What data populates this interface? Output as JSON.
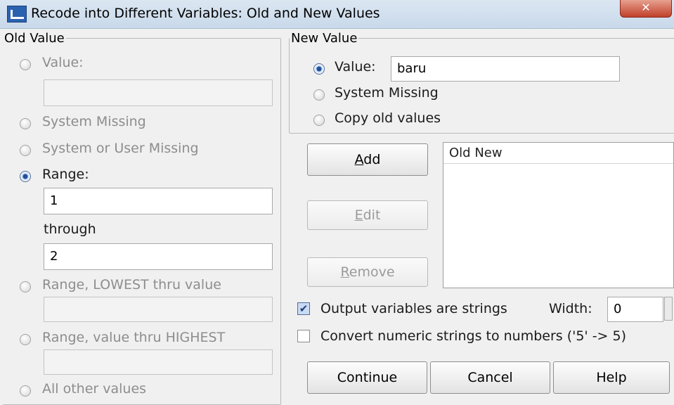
{
  "window": {
    "title": "Recode into Different Variables: Old and New Values",
    "close_label": "✕"
  },
  "old_value": {
    "legend": "Old Value",
    "value_label": "Value:",
    "system_missing_label": "System Missing",
    "system_or_user_missing_label": "System or User Missing",
    "range_label": "Range:",
    "range_from": "1",
    "through_label": "through",
    "range_to": "2",
    "range_lowest_label": "Range, LOWEST thru value",
    "range_highest_label": "Range, value thru HIGHEST",
    "all_other_label": "All other values"
  },
  "new_value": {
    "legend": "New Value",
    "value_label": "Value:",
    "value_input": "baru",
    "system_missing_label": "System Missing",
    "copy_old_label": "Copy old values"
  },
  "buttons": {
    "add_key": "A",
    "add_rest": "dd",
    "edit_key": "E",
    "edit_rest": "dit",
    "remove_key": "R",
    "remove_rest": "emove",
    "continue": "Continue",
    "cancel": "Cancel",
    "help": "Help"
  },
  "mapping_list": {
    "header": "Old New"
  },
  "options": {
    "output_strings_label": "Output variables are strings",
    "output_strings_checked": true,
    "width_label": "Width:",
    "width_value": "0",
    "convert_numeric_label": "Convert numeric strings to numbers ('5' -> 5)",
    "convert_numeric_checked": false
  }
}
